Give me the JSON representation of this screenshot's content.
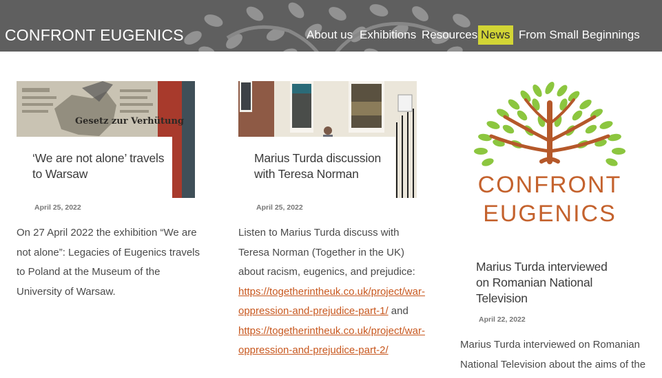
{
  "header": {
    "logo": "CONFRONT EUGENICS",
    "nav": [
      {
        "label": "About us",
        "active": false
      },
      {
        "label": "Exhibitions",
        "active": false
      },
      {
        "label": "Resources",
        "active": false
      },
      {
        "label": "News",
        "active": true
      },
      {
        "label": "From Small Beginnings",
        "active": false
      }
    ],
    "active_color": "#d2d535"
  },
  "posts": [
    {
      "title": "‘We are not alone’ travels to Warsaw",
      "date": "April 25, 2022",
      "excerpt": "On 27 April 2022 the exhibition “We are not alone”: Legacies of Eugenics travels to Poland at the Museum of the University of Warsaw.",
      "image_text": "Gesetz zur Verhütung"
    },
    {
      "title": "Marius Turda discussion with Teresa Norman",
      "date": "April 25, 2022",
      "excerpt_intro": "Listen to Marius Turda discuss with Teresa Norman (Together in the UK) about racism, eugenics, and prejudice:",
      "link1": "https://togetherintheuk.co.uk/project/war-oppression-and-prejudice-part-1/",
      "link_and": " and",
      "link2": "https://togetherintheuk.co.uk/project/war-oppression-and-prejudice-part-2/"
    },
    {
      "title": "Marius Turda interviewed on Romanian National Television",
      "date": "April 22, 2022",
      "excerpt": "Marius Turda interviewed on Romanian National Television about the aims of the",
      "logo_line1": "CONFRONT",
      "logo_line2": "EUGENICS"
    }
  ],
  "colors": {
    "header_bg": "#5f5f5f",
    "link": "#c8581f",
    "logo_orange": "#c4622d",
    "tree_brown": "#b5582a",
    "leaf_green": "#8cc63f"
  }
}
